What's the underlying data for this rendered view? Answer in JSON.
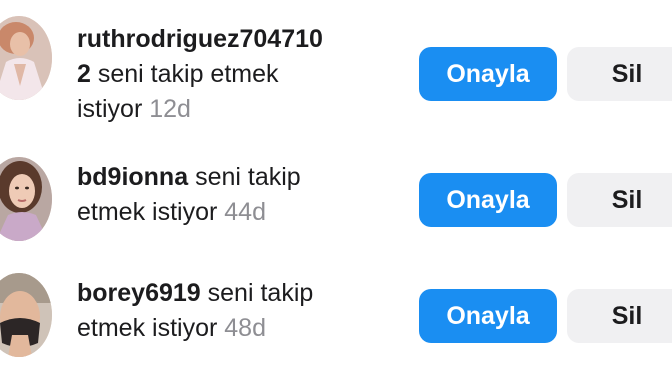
{
  "requests": [
    {
      "username": "ruthrodriguez704710",
      "line2_tail": "2",
      "message_line2": "seni takip etmek",
      "message_line3": "istiyor",
      "time": "12d",
      "confirm_label": "Onayla",
      "delete_label": "Sil"
    },
    {
      "username": "bd9ionna",
      "message_line1": "seni takip",
      "message_line2": "etmek istiyor",
      "time": "44d",
      "confirm_label": "Onayla",
      "delete_label": "Sil"
    },
    {
      "username": "borey6919",
      "message_line1": "seni takip",
      "message_line2": "etmek istiyor",
      "time": "48d",
      "confirm_label": "Onayla",
      "delete_label": "Sil"
    }
  ],
  "colors": {
    "confirm_button": "#1a8ef2",
    "delete_button": "#f0f0f2",
    "timestamp": "#8e8e93"
  },
  "icons": [
    "avatar-photo"
  ]
}
